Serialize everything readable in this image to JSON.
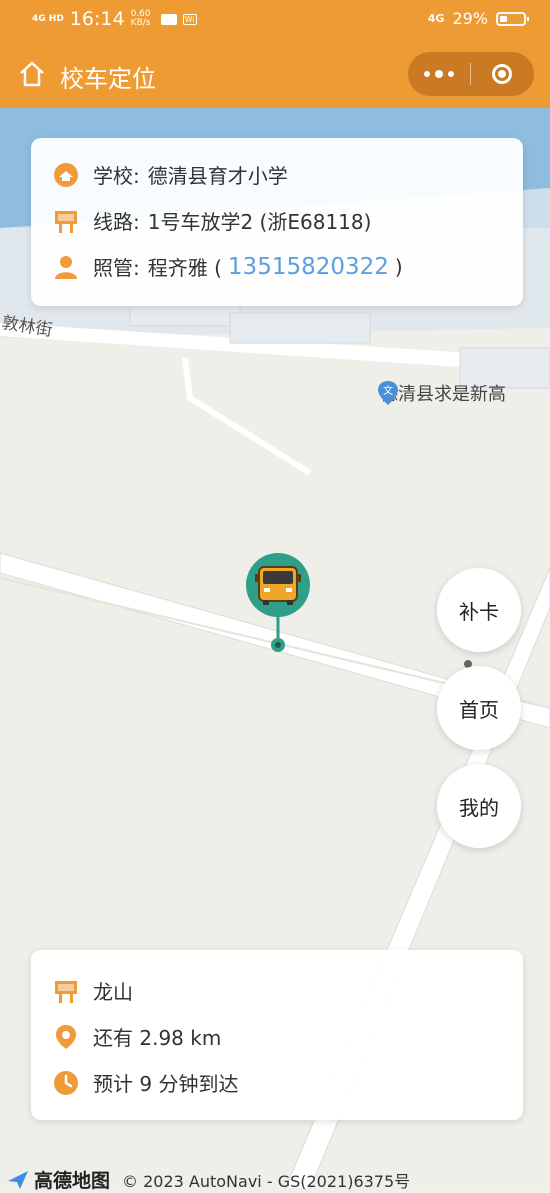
{
  "status_bar": {
    "network": "4G HD",
    "time": "16:14",
    "speed_value": "0.60",
    "speed_unit": "KB/s",
    "wifi_badge": "Wi",
    "signal": "4G",
    "battery": "29%"
  },
  "header": {
    "title": "校车定位"
  },
  "info_card": {
    "school_label": "学校:",
    "school_value": "德清县育才小学",
    "route_label": "线路:",
    "route_value": "1号车放学2 (浙E68118)",
    "caretaker_label": "照管:",
    "caretaker_name": "程齐雅 (",
    "caretaker_phone": "13515820322",
    "caretaker_close": ")"
  },
  "map": {
    "street_label": "敦林街",
    "poi_label": "德清县求是新高"
  },
  "buttons": {
    "makeup": "补卡",
    "home": "首页",
    "mine": "我的"
  },
  "eta_card": {
    "stop": "龙山",
    "distance": "还有 2.98 km",
    "eta": "预计 9 分钟到达"
  },
  "attribution": {
    "brand": "高德地图",
    "copyright": "© 2023 AutoNavi - GS(2021)6375号"
  },
  "colors": {
    "brand_orange": "#ef9b33",
    "icon_orange": "#f09a3a",
    "phone_blue": "#5aa0e0",
    "bus_marker_teal": "#2f9f8a"
  }
}
